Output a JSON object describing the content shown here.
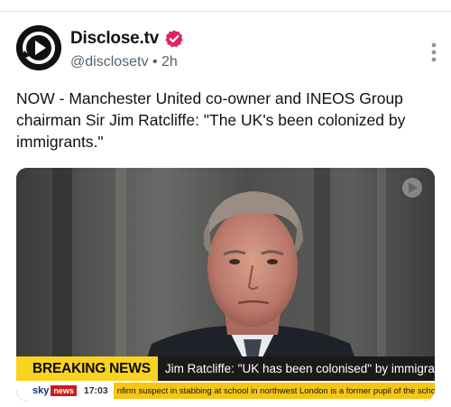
{
  "account": {
    "name": "Disclose.tv",
    "handle": "@disclosetv",
    "separator": "•",
    "time": "2h",
    "verified_color": "#e0245e"
  },
  "post": {
    "text": "NOW - Manchester United co-owner and INEOS Group chairman Sir Jim Ratcliffe: \"The UK's been colonized by immigrants.\""
  },
  "media": {
    "breaking_label": "BREAKING NEWS",
    "headline": "Jim Ratcliffe: \"UK has been colonised\" by immigrants",
    "channel_sky": "sky",
    "channel_news": "news",
    "ticker_time": "17:03",
    "ticker_text": "nfirm suspect in stabbing at school in northwest London is a former pupil of the school an"
  },
  "icons": {
    "avatar": "play-logo-icon",
    "verified": "verified-badge-icon",
    "more": "more-vertical-icon",
    "watermark": "play-watermark-icon"
  }
}
